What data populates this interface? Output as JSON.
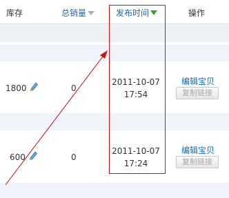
{
  "table": {
    "headers": {
      "stock": "库存",
      "sales": "总销量",
      "publish_time": "发布时间",
      "operations": "操作"
    },
    "rows": [
      {
        "stock": "1800",
        "sales": "0",
        "date": "2011-10-07",
        "time": "17:54",
        "edit_label": "编辑宝贝",
        "copy_label": "复制链接"
      },
      {
        "stock": "600",
        "sales": "0",
        "date": "2011-10-07",
        "time": "17:24",
        "edit_label": "编辑宝贝",
        "copy_label": "复制链接"
      }
    ]
  },
  "icons": {
    "sales_sort": "sort-down-arrow-gray",
    "time_sort": "sort-down-arrow-green",
    "stock_edit": "pencil-icon"
  },
  "colors": {
    "link": "#0a6eb9",
    "header_link": "#2469a8",
    "annotation": "#cc1111",
    "sort_active": "#3aa02c"
  }
}
